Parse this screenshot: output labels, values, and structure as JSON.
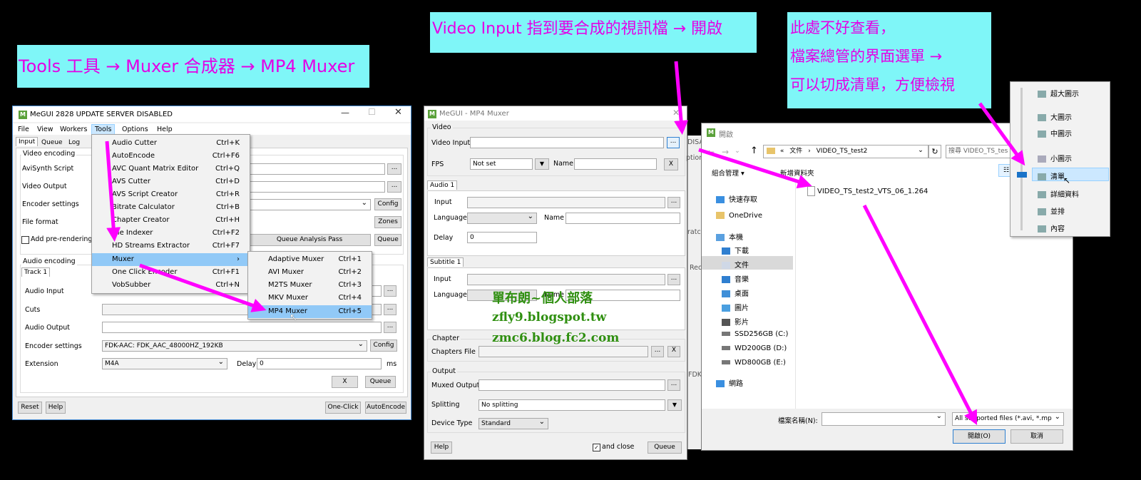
{
  "callouts": {
    "tools": "Tools 工具 → Muxer 合成器 → MP4 Muxer",
    "video_input": "Video Input 指到要合成的視訊檔 → 開啟",
    "view_line1": "此處不好查看，",
    "view_line2": "檔案總管的界面選單 →",
    "view_line3": "可以切成清單，方便檢視"
  },
  "megui": {
    "title": "MeGUI 2828 UPDATE SERVER DISABLED",
    "menubar": [
      "File",
      "View",
      "Workers",
      "Tools",
      "Options",
      "Help"
    ],
    "tabs": [
      "Input",
      "Queue",
      "Log"
    ],
    "video_group": "Video encoding",
    "avisynth": "AviSynth Script",
    "video_output": "Video Output",
    "encoder_settings": "Encoder settings",
    "file_format": "File format",
    "add_prerender": "Add pre-rendering jo",
    "config": "Config",
    "zones": "Zones",
    "queue_analysis": "Queue Analysis Pass",
    "queue": "Queue",
    "audio_group": "Audio encoding",
    "track_tab": "Track 1",
    "audio_input": "Audio Input",
    "cuts": "Cuts",
    "audio_output": "Audio Output",
    "audio_encoder_settings": "Encoder settings",
    "audio_encoder_value": "FDK-AAC: FDK_AAC_48000HZ_192KB",
    "extension": "Extension",
    "extension_value": "M4A",
    "delay": "Delay",
    "delay_value": "0",
    "ms": "ms",
    "x": "X",
    "reset": "Reset",
    "help": "Help",
    "one_click": "One-Click",
    "autoencode": "AutoEncode",
    "browse": "..."
  },
  "tools_menu": [
    {
      "label": "Audio Cutter",
      "key": "Ctrl+K"
    },
    {
      "label": "AutoEncode",
      "key": "Ctrl+F6"
    },
    {
      "label": "AVC Quant Matrix Editor",
      "key": "Ctrl+Q"
    },
    {
      "label": "AVS Cutter",
      "key": "Ctrl+D"
    },
    {
      "label": "AVS Script Creator",
      "key": "Ctrl+R"
    },
    {
      "label": "Bitrate Calculator",
      "key": "Ctrl+B"
    },
    {
      "label": "Chapter Creator",
      "key": "Ctrl+H"
    },
    {
      "label": "File Indexer",
      "key": "Ctrl+F2"
    },
    {
      "label": "HD Streams Extractor",
      "key": "Ctrl+F7"
    },
    {
      "label": "Muxer",
      "key": "›"
    },
    {
      "label": "One Click Encoder",
      "key": "Ctrl+F1"
    },
    {
      "label": "VobSubber",
      "key": "Ctrl+N"
    }
  ],
  "muxer_submenu": [
    {
      "label": "Adaptive Muxer",
      "key": "Ctrl+1"
    },
    {
      "label": "AVI Muxer",
      "key": "Ctrl+2"
    },
    {
      "label": "M2TS Muxer",
      "key": "Ctrl+3"
    },
    {
      "label": "MKV Muxer",
      "key": "Ctrl+4"
    },
    {
      "label": "MP4 Muxer",
      "key": "Ctrl+5"
    }
  ],
  "mp4": {
    "title": "MeGUI - MP4 Muxer",
    "video": "Video",
    "video_input": "Video Input",
    "fps": "FPS",
    "fps_value": "Not set",
    "name": "Name",
    "x": "X",
    "audio_tab": "Audio 1",
    "input": "Input",
    "language": "Language",
    "delay": "Delay",
    "delay_value": "0",
    "subtitle_tab": "Subtitle 1",
    "chapter": "Chapter",
    "chapters_file": "Chapters File",
    "output": "Output",
    "muxed_output": "Muxed Output",
    "splitting": "Splitting",
    "splitting_value": "No splitting",
    "device_type": "Device Type",
    "device_value": "Standard",
    "help": "Help",
    "and_close": "and close",
    "queue": "Queue",
    "browse": "..."
  },
  "background_fragments": [
    "DISA",
    "ption",
    "ratch",
    "Reo",
    "FDK"
  ],
  "open_dialog": {
    "title": "開啟",
    "breadcrumb": [
      "«",
      "文件",
      "›",
      "VIDEO_TS_test2"
    ],
    "search_placeholder": "搜尋 VIDEO_TS_tes",
    "organize": "組合管理 ▾",
    "new_folder": "新增資料夾",
    "nav": [
      "快速存取",
      "OneDrive",
      "本機",
      "下載",
      "文件",
      "音樂",
      "桌面",
      "圖片",
      "影片",
      "SSD256GB (C:)",
      "WD200GB (D:)",
      "WD800GB (E:)",
      "網路"
    ],
    "file": "VIDEO_TS_test2_VTS_06_1.264",
    "filename_label": "檔案名稱(N):",
    "filter": "All supported files (*.avi, *.mp",
    "open": "開啟(O)",
    "cancel": "取消"
  },
  "view_menu": [
    "超大圖示",
    "大圖示",
    "中圖示",
    "小圖示",
    "清單",
    "詳細資料",
    "並排",
    "內容"
  ],
  "watermark": {
    "line1": "單布朗~個人部落",
    "line2": "zfly9.blogspot.tw",
    "line3": "zmc6.blog.fc2.com"
  },
  "colors": {
    "callout_bg": "#7ff6f8",
    "callout_text": "#e400e6",
    "arrow": "#ff00ff",
    "menu_highlight": "#91c9f7"
  }
}
